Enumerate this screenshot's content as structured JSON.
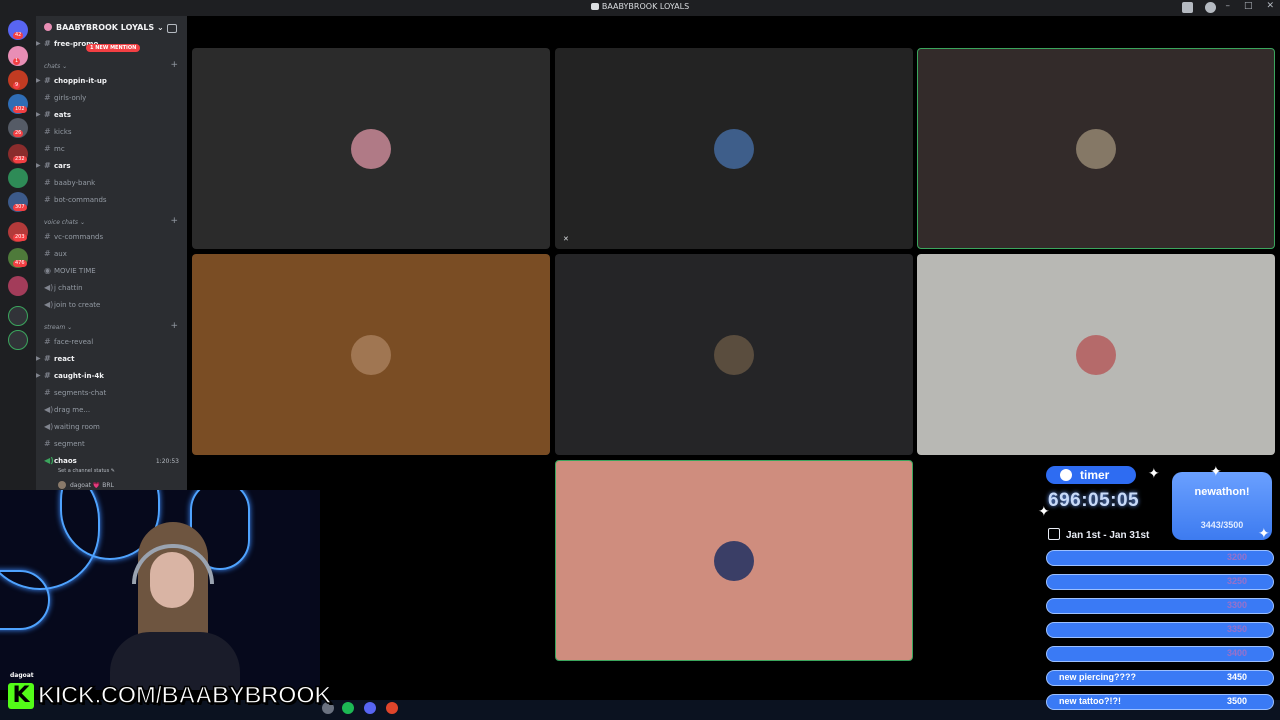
{
  "window": {
    "title": "BAABYBROOK LOYALS",
    "minimize": "–",
    "maximize": "□",
    "close": "✕"
  },
  "servers": {
    "badges": [
      "42",
      "1",
      "9",
      "102",
      "26",
      "232",
      "307",
      "203",
      "476"
    ]
  },
  "sidebar": {
    "guild_name": "BAABYBROOK LOYALS ⌄",
    "mention_badge": "1 NEW MENTION",
    "top_channel": "free-promo",
    "categories": {
      "chats": "chats ⌄",
      "voice": "voice chats ⌄",
      "stream": "stream ⌄"
    },
    "chats": [
      {
        "icon": "#",
        "label": "choppin-it-up",
        "bold": true
      },
      {
        "icon": "#",
        "label": "girls-only",
        "bold": false
      },
      {
        "icon": "#",
        "label": "eats",
        "bold": true
      },
      {
        "icon": "#",
        "label": "kicks",
        "bold": false
      },
      {
        "icon": "#",
        "label": "mc",
        "bold": false
      },
      {
        "icon": "#",
        "label": "cars",
        "bold": true
      },
      {
        "icon": "#",
        "label": "baaby-bank",
        "bold": false
      },
      {
        "icon": "#",
        "label": "bot-commands",
        "bold": false
      }
    ],
    "voice": [
      {
        "icon": "#",
        "label": "vc-commands"
      },
      {
        "icon": "#",
        "label": "aux"
      },
      {
        "icon": "◉",
        "label": "MOVIE TIME"
      },
      {
        "icon": "◀)",
        "label": "j chattin"
      },
      {
        "icon": "◀)",
        "label": "join to create"
      }
    ],
    "stream": [
      {
        "icon": "#",
        "label": "face-reveal",
        "bold": false
      },
      {
        "icon": "#",
        "label": "react",
        "bold": true
      },
      {
        "icon": "#",
        "label": "caught-in-4k",
        "bold": true
      },
      {
        "icon": "#",
        "label": "segments-chat",
        "bold": false
      },
      {
        "icon": "◀)",
        "label": "drag me...",
        "bold": false
      },
      {
        "icon": "◀)",
        "label": "waiting room",
        "bold": false
      },
      {
        "icon": "#",
        "label": "segment",
        "bold": false
      }
    ],
    "active_voice": {
      "label": "chaos",
      "elapsed": "1:20:53",
      "status": "Set a channel status ✎",
      "member": "dagoat",
      "member_tag": "💗 BRL"
    }
  },
  "tiles": [
    {
      "color": "#2b2b2b",
      "avatar_color": "#b07a86",
      "border": "none"
    },
    {
      "color": "#232323",
      "avatar_color": "#3e5e8a",
      "border": "none",
      "muted": true
    },
    {
      "color": "#332b2a",
      "avatar_color": "#857866",
      "border": "#3ba55d"
    },
    {
      "color": "#7a4d24",
      "avatar_color": "#a07652",
      "border": "none"
    },
    {
      "color": "#252527",
      "avatar_color": "#5a4d3e",
      "border": "none"
    },
    {
      "color": "#b8b8b4",
      "avatar_color": "#b56a6a",
      "border": "none"
    },
    {
      "color": "#cf8d7e",
      "avatar_color": "#3a3e66",
      "border": "#3ba55d"
    }
  ],
  "webcam": {
    "username": "dagoat"
  },
  "overlay": {
    "kick_letter": "K",
    "kick_url": "KICK.COM/BAABYBROOK",
    "timer_label": "timer",
    "timer_value": "696:05:05",
    "date_range": "Jan 1st - Jan 31st",
    "goal_title": "newathon!",
    "goal_progress": "3443/3500",
    "goals": [
      {
        "label": "",
        "value": "3200",
        "dim": true
      },
      {
        "label": "",
        "value": "3250",
        "dim": true
      },
      {
        "label": "",
        "value": "3300",
        "dim": true
      },
      {
        "label": "",
        "value": "3350",
        "dim": true
      },
      {
        "label": "",
        "value": "3400",
        "dim": true
      },
      {
        "label": "new piercing????",
        "value": "3450",
        "dim": false
      },
      {
        "label": "new tattoo?!?!",
        "value": "3500",
        "dim": false
      }
    ]
  }
}
